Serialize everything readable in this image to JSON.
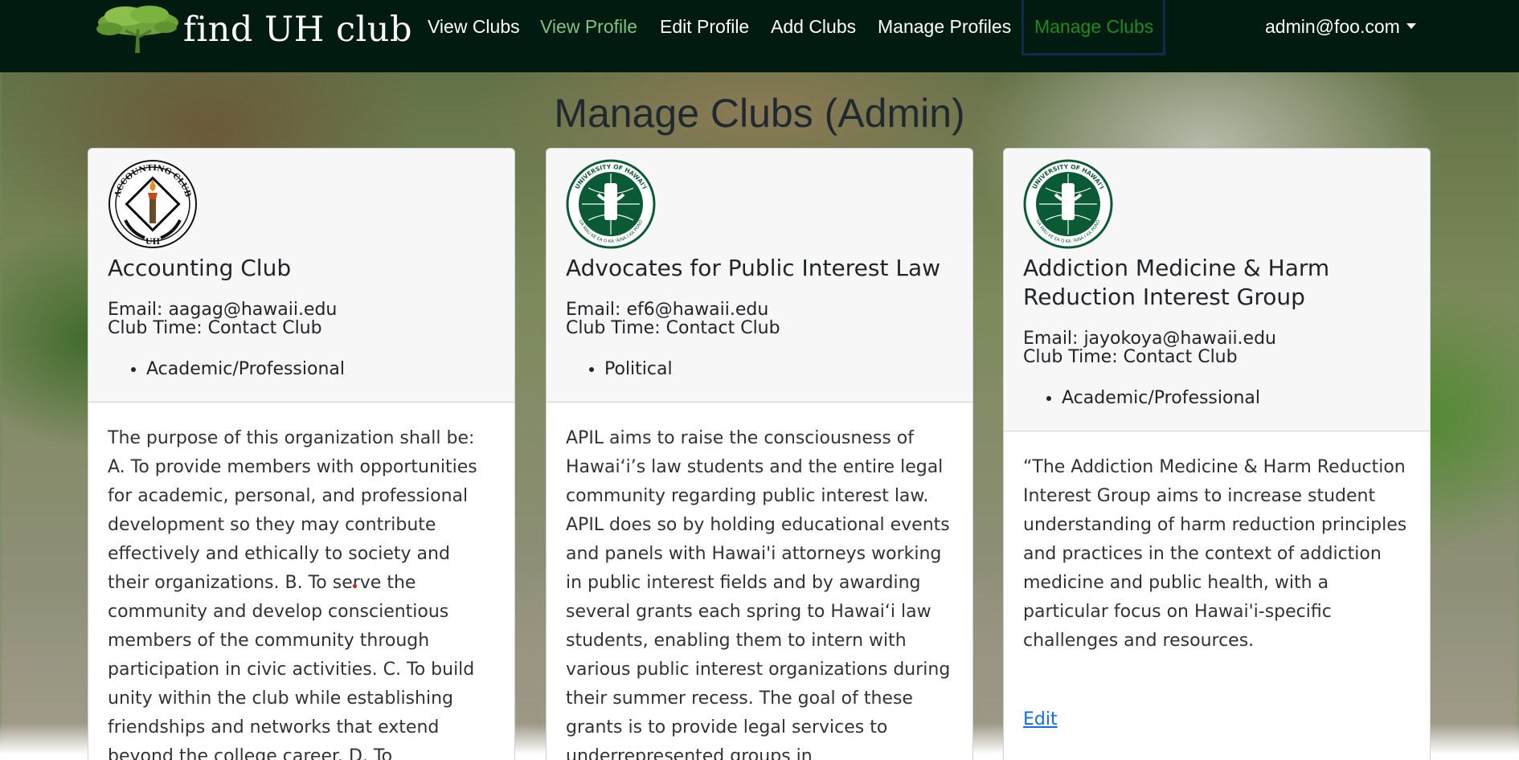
{
  "navbar": {
    "brand_text": "find UH club",
    "links": [
      {
        "label": "View Clubs"
      },
      {
        "label": "View Profile"
      },
      {
        "label": "Edit Profile"
      },
      {
        "label": "Add Clubs"
      },
      {
        "label": "Manage Profiles"
      },
      {
        "label": "Manage Clubs"
      }
    ],
    "user": "admin@foo.com",
    "colors": {
      "background": "#021b10",
      "link": "#ffffff",
      "link_green": "#7ec383",
      "active": "#1e8a24"
    }
  },
  "page": {
    "title": "Manage Clubs (Admin)"
  },
  "clubs": [
    {
      "logo_text_top": "ACCOUNTING CLUB",
      "logo_text_bottom": "UH",
      "name": "Accounting Club",
      "email": "Email: aagag@hawaii.edu",
      "time": "Club Time: Contact Club",
      "tags": [
        "Academic/Professional"
      ],
      "description": "The purpose of this organization shall be: A. To provide members with opportunities for academic, personal, and professional development so they may contribute effectively and ethically to society and their organizations. B. To serve the community and develop conscientious members of the community through participation in civic activities. C. To build unity within the club while establishing friendships and networks that extend beyond the college career. D. To"
    },
    {
      "logo_text_top": "UNIVERSITY OF HAWAI'I",
      "logo_text_bottom": "UA MAU KE EA O KA ʻĀINA I KA PONO",
      "name": "Advocates for Public Interest Law",
      "email": "Email: ef6@hawaii.edu",
      "time": "Club Time: Contact Club",
      "tags": [
        "Political"
      ],
      "description": "APIL aims to raise the consciousness of Hawai‘i’s law students and the entire legal community regarding public interest law. APIL does so by holding educational events and panels with Hawai'i attorneys working in public interest fields and by awarding several grants each spring to Hawai‘i law students, enabling them to intern with various public interest organizations during their summer recess. The goal of these grants is to provide legal services to underrepresented groups in"
    },
    {
      "logo_text_top": "UNIVERSITY OF HAWAI'I",
      "logo_text_bottom": "UA MAU KE EA O KA ʻĀINA I KA PONO",
      "name": "Addiction Medicine & Harm Reduction Interest Group",
      "email": "Email: jayokoya@hawaii.edu",
      "time": "Club Time: Contact Club",
      "tags": [
        "Academic/Professional"
      ],
      "description": "“The Addiction Medicine & Harm Reduction Interest Group aims to increase student understanding of harm reduction principles and practices in the context of addiction medicine and public health, with a particular focus on Hawai'i-specific challenges and resources.",
      "edit_label": "Edit"
    }
  ],
  "icons": {
    "brand": "tree-icon",
    "user_menu": "caret-down-icon",
    "club_logos": [
      "accounting-club-seal-icon",
      "uh-seal-icon",
      "uh-seal-icon"
    ]
  }
}
